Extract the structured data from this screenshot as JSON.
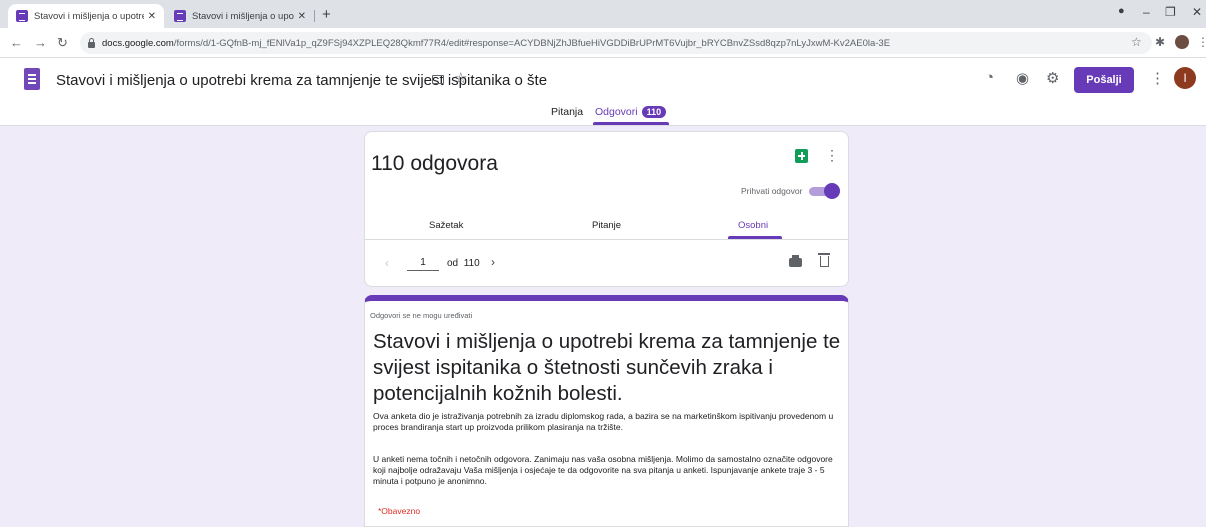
{
  "browser": {
    "tabs": [
      {
        "title": "Stavovi i mišljenja o upotrebi kre",
        "close": "✕"
      },
      {
        "title": "Stavovi i mišljenja o upotrebi kre",
        "close": "✕"
      }
    ],
    "new_tab": "+",
    "url_host": "docs.google.com",
    "url_path": "/forms/d/1-GQfnB-mj_fENlVa1p_qZ9FSj94XZPLEQ28Qkmf77R4/edit#response=ACYDBNjZhJBfueHiVGDDiBrUPrMT6Vujbr_bRYCBnvZSsd8qzp7nLyJxwM-Kv2AE0la-3E"
  },
  "header": {
    "title": "Stavovi i mišljenja o upotrebi krema za tamnjenje te svijest ispitanika o šte",
    "send_label": "Pošalji",
    "avatar_initial": "I",
    "tabs": [
      {
        "label": "Pitanja"
      },
      {
        "label": "Odgovori",
        "count": "110"
      }
    ]
  },
  "summary": {
    "response_count": "110 odgovora",
    "accepting_label": "Prihvati odgovor",
    "accepting_enabled": true,
    "subtabs": [
      {
        "label": "Sažetak"
      },
      {
        "label": "Pitanje"
      },
      {
        "label": "Osobni"
      }
    ],
    "pager": {
      "current": "1",
      "of": "od",
      "total": "110"
    }
  },
  "form": {
    "not_editable": "Odgovori se ne mogu uređivati",
    "title": "Stavovi i mišljenja o upotrebi krema za tamnjenje te svijest ispitanika o štetnosti sunčevih zraka i potencijalnih kožnih bolesti.",
    "description_1": "Ova anketa dio je istraživanja potrebnih za izradu diplomskog rada, a bazira se na marketinškom ispitivanju provedenom u proces brandiranja start up proizvoda prilikom plasiranja na tržište.",
    "description_2": "U anketi nema točnih i netočnih odgovora. Zanimaju nas vaša osobna mišljenja. Molimo da samostalno označite odgovore koji najbolje odražavaju Vaša mišljenja i osjećaje te da odgovorite na sva pitanja u anketi. Ispunjavanje ankete traje 3 - 5 minuta i potpuno je anonimno.",
    "required_note": "*Obavezno"
  },
  "colors": {
    "accent": "#673ab7",
    "background": "#f0ebf8",
    "required": "#d93025",
    "sheets": "#0f9d58"
  }
}
